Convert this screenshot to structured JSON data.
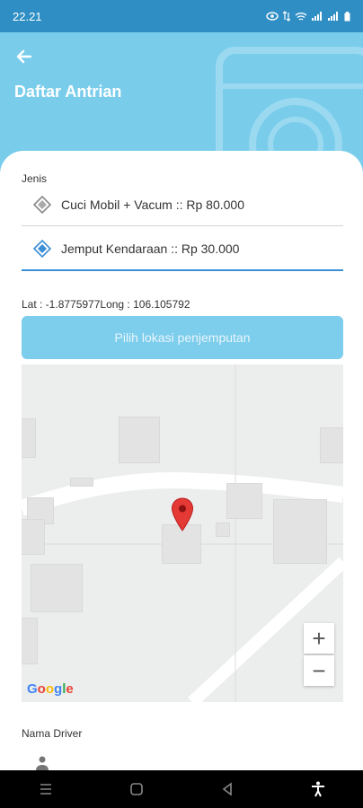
{
  "status": {
    "time": "22.21"
  },
  "header": {
    "title": "Daftar Antrian",
    "back_icon": "arrow-left-icon",
    "color": "#79cdeb"
  },
  "form": {
    "jenis_label": "Jenis",
    "options": [
      {
        "label": "Cuci Mobil + Vacum :: Rp 80.000",
        "icon": "tag-icon",
        "selected": false
      },
      {
        "label": "Jemput Kendaraan :: Rp 30.000",
        "icon": "tag-icon",
        "selected": true
      }
    ],
    "coordinates": "Lat : -1.8775977Long : 106.105792",
    "pick_location_button": "Pilih lokasi penjemputan",
    "driver_label": "Nama Driver"
  },
  "map": {
    "zoom_in": "+",
    "zoom_out": "−",
    "logo": "Google"
  },
  "colors": {
    "accent": "#3a8fd6",
    "button": "#7dcdec",
    "pin": "#e53935"
  }
}
